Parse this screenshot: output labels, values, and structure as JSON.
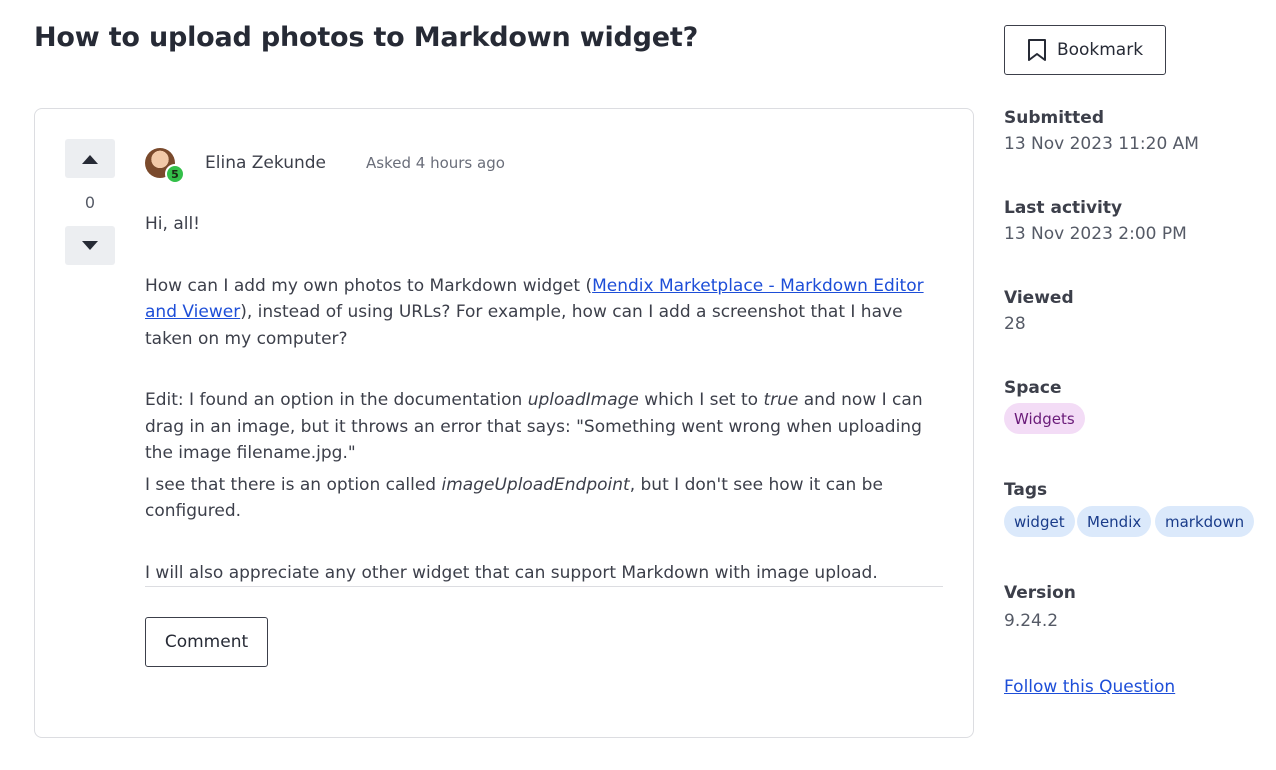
{
  "question": {
    "title": "How to upload photos to Markdown widget?",
    "vote_count": "0",
    "author": "Elina Zekunde",
    "author_badge": "5",
    "asked": "Asked 4 hours ago",
    "body": {
      "p1": "Hi, all!",
      "p2_before": "How can I add my own photos to Markdown widget (",
      "p2_link": "Mendix Marketplace - Markdown Editor and Viewer",
      "p2_after": "), instead of using URLs? For example, how can I add a screenshot that I have taken on my computer?",
      "p3_a": "Edit: I found an option in the documentation ",
      "p3_em1": "uploadImage",
      "p3_b": " which I set to ",
      "p3_em2": "true",
      "p3_c": " and now I can drag in an image, but it throws an error that says: \"Something went wrong when uploading the image filename.jpg.\"",
      "p4_a": "I see that there is an option called ",
      "p4_em": "imageUploadEndpoint",
      "p4_b": ", but I don't see how it can be configured.",
      "p5": "I will also appreciate any other widget that can support Markdown with image upload."
    },
    "comment_label": "Comment"
  },
  "sidebar": {
    "bookmark_label": "Bookmark",
    "submitted_label": "Submitted",
    "submitted_value": "13 Nov 2023 11:20 AM",
    "last_activity_label": "Last activity",
    "last_activity_value": "13 Nov 2023 2:00 PM",
    "viewed_label": "Viewed",
    "viewed_value": "28",
    "space_label": "Space",
    "space_value": "Widgets",
    "tags_label": "Tags",
    "tags": [
      "widget",
      "Mendix",
      "markdown"
    ],
    "version_label": "Version",
    "version_value": "9.24.2",
    "follow_label": "Follow this Question"
  },
  "colors": {
    "link": "#1d4ed8",
    "badge_green": "#33bf49",
    "space_tag_bg": "#f3dcf6",
    "tag_bg": "#dbe9fb"
  },
  "icons": [
    "upvote-icon",
    "downvote-icon",
    "bookmark-icon"
  ]
}
